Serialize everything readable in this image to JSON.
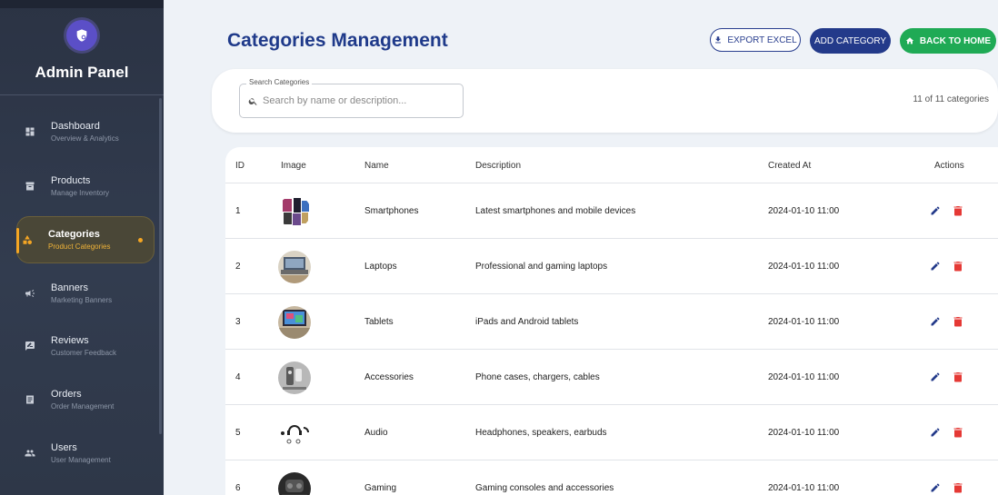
{
  "sidebar": {
    "title": "Admin Panel",
    "items": [
      {
        "label": "Dashboard",
        "sub": "Overview & Analytics",
        "icon": "dashboard-icon"
      },
      {
        "label": "Products",
        "sub": "Manage Inventory",
        "icon": "inventory-icon"
      },
      {
        "label": "Categories",
        "sub": "Product Categories",
        "icon": "category-icon",
        "active": true
      },
      {
        "label": "Banners",
        "sub": "Marketing Banners",
        "icon": "campaign-icon"
      },
      {
        "label": "Reviews",
        "sub": "Customer Feedback",
        "icon": "rate-review-icon"
      },
      {
        "label": "Orders",
        "sub": "Order Management",
        "icon": "receipt-icon"
      },
      {
        "label": "Users",
        "sub": "User Management",
        "icon": "people-icon"
      }
    ]
  },
  "header": {
    "title": "Categories Management",
    "export_label": "EXPORT EXCEL",
    "add_label": "ADD CATEGORY",
    "back_label": "BACK TO HOME"
  },
  "search": {
    "legend": "Search Categories",
    "placeholder": "Search by name or description...",
    "value": "",
    "count": "11 of 11 categories"
  },
  "table": {
    "headers": [
      "ID",
      "Image",
      "Name",
      "Description",
      "Created At",
      "Actions"
    ],
    "rows": [
      {
        "id": "1",
        "name": "Smartphones",
        "description": "Latest smartphones and mobile devices",
        "created": "2024-01-10 11:00"
      },
      {
        "id": "2",
        "name": "Laptops",
        "description": "Professional and gaming laptops",
        "created": "2024-01-10 11:00"
      },
      {
        "id": "3",
        "name": "Tablets",
        "description": "iPads and Android tablets",
        "created": "2024-01-10 11:00"
      },
      {
        "id": "4",
        "name": "Accessories",
        "description": "Phone cases, chargers, cables",
        "created": "2024-01-10 11:00"
      },
      {
        "id": "5",
        "name": "Audio",
        "description": "Headphones, speakers, earbuds",
        "created": "2024-01-10 11:00"
      },
      {
        "id": "6",
        "name": "Gaming",
        "description": "Gaming consoles and accessories",
        "created": "2024-01-10 11:00"
      }
    ]
  },
  "colors": {
    "primary": "#233a8a",
    "success": "#1faa55",
    "danger": "#e53935",
    "accent": "#f5a623"
  }
}
